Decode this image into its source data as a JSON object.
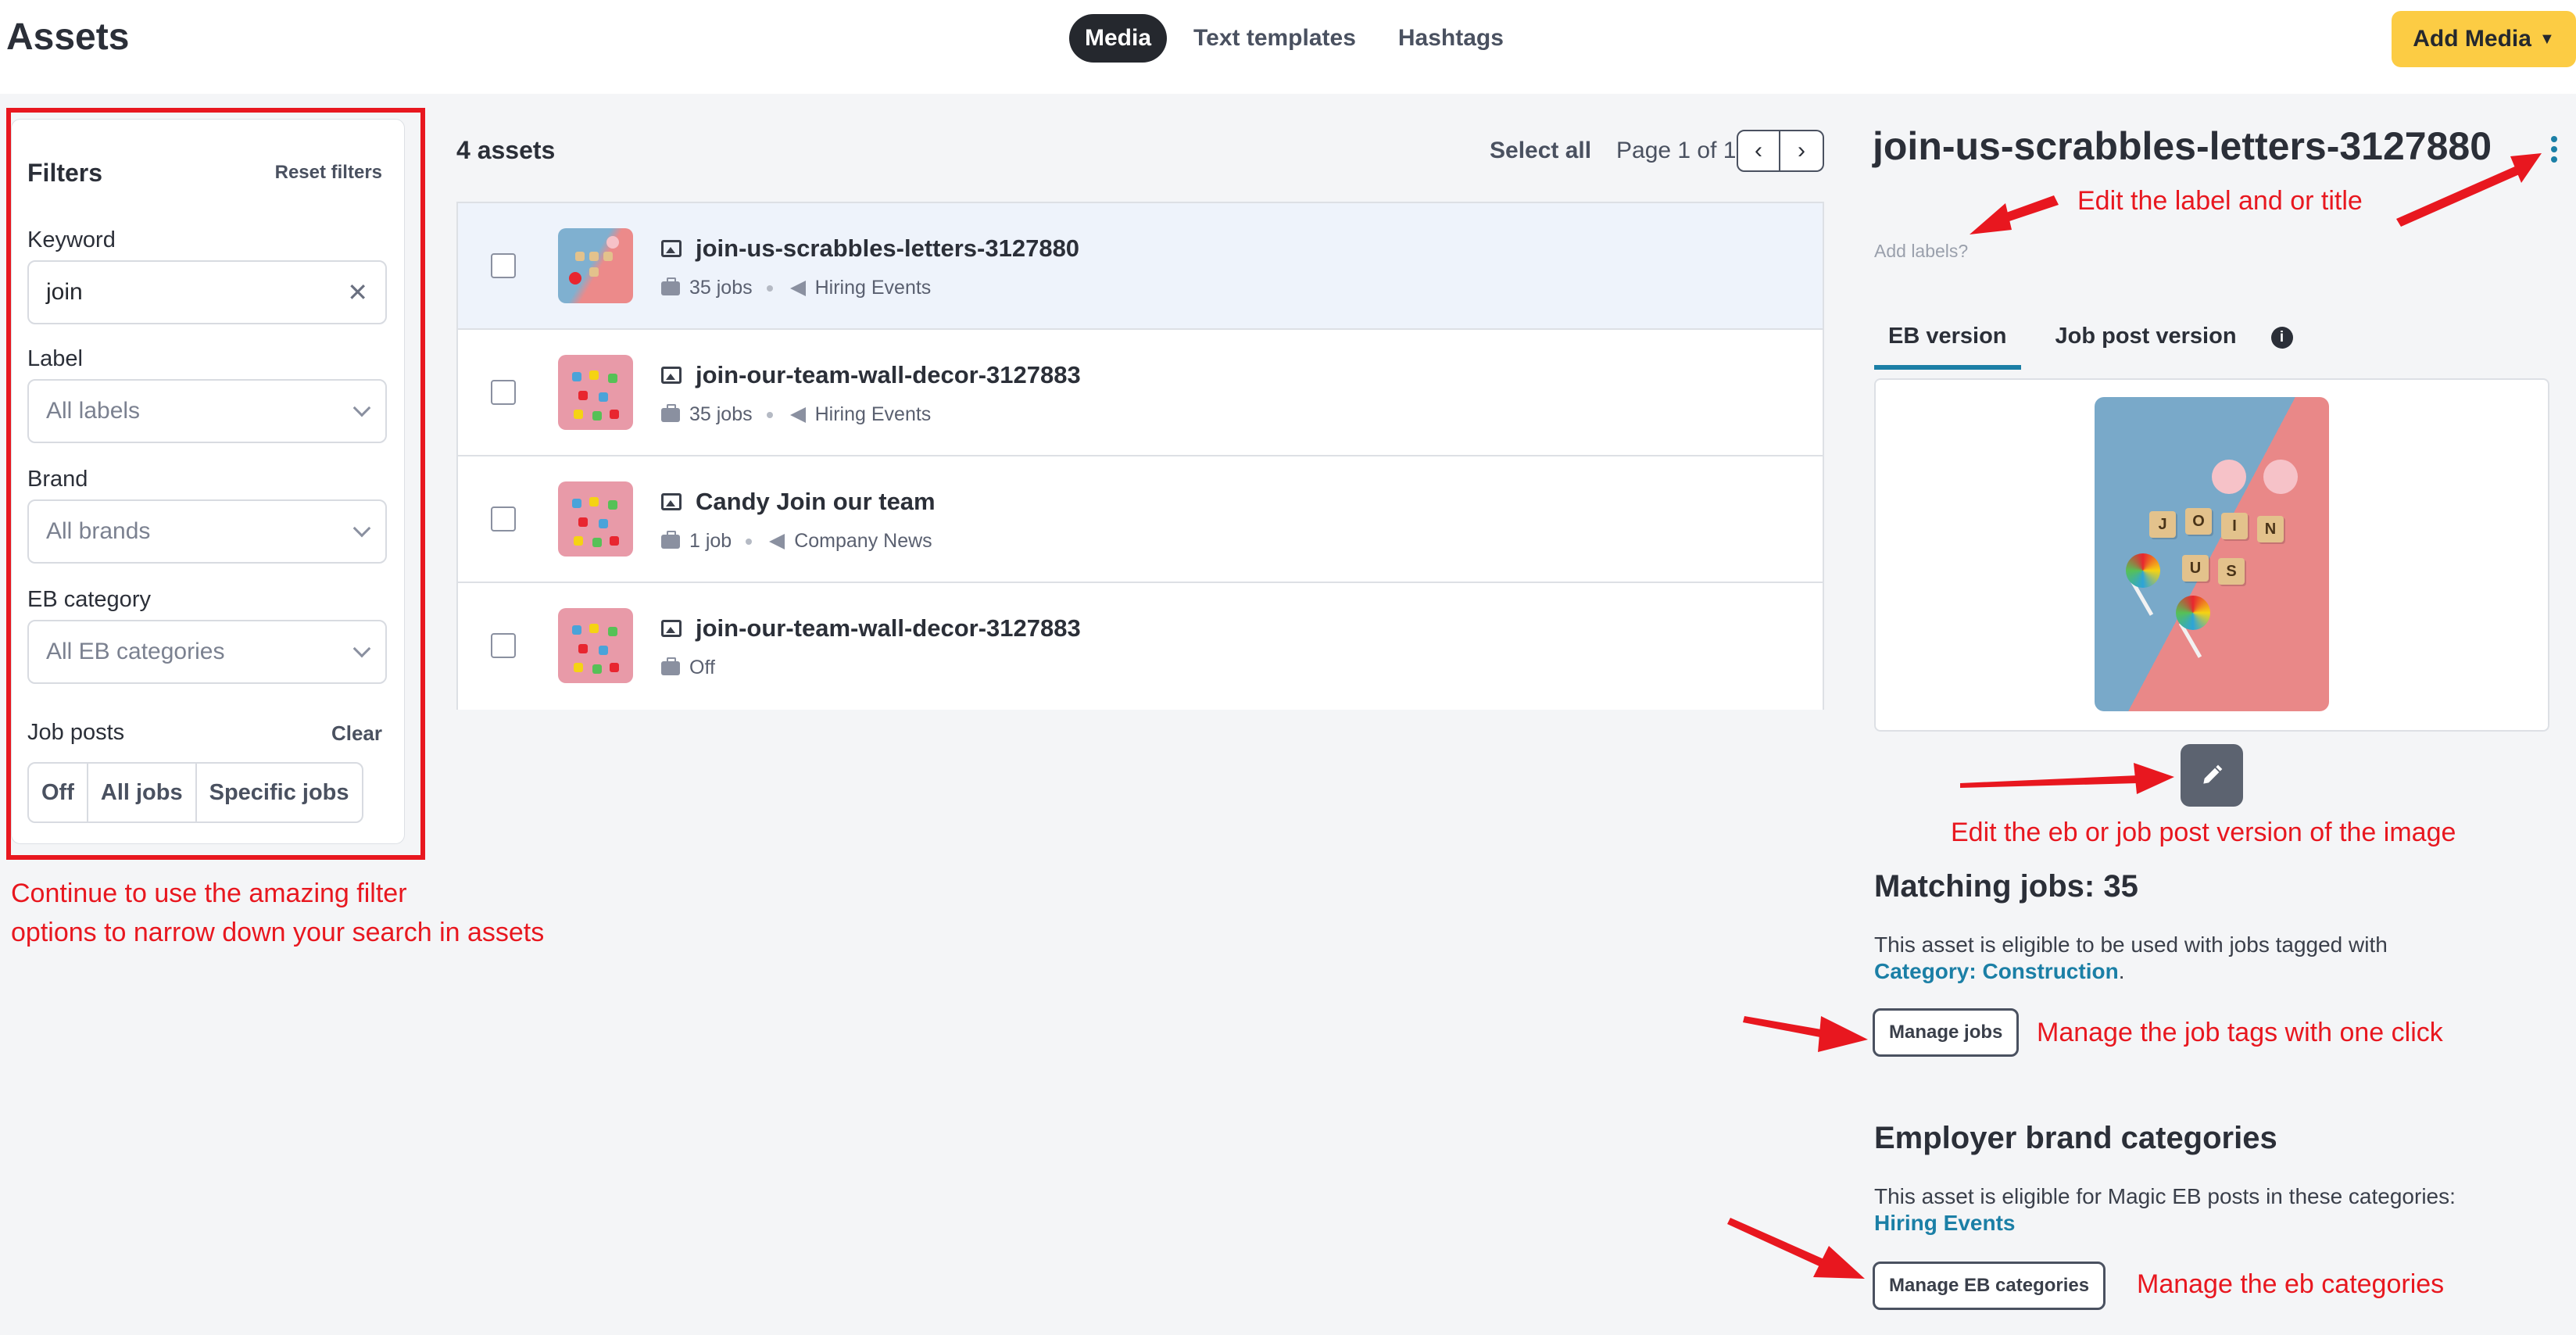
{
  "header": {
    "title": "Assets",
    "tabs": [
      "Media",
      "Text templates",
      "Hashtags"
    ],
    "active_tab": "Media",
    "add_media_label": "Add Media"
  },
  "filters": {
    "title": "Filters",
    "reset_label": "Reset filters",
    "keyword_label": "Keyword",
    "keyword_value": "join",
    "label_label": "Label",
    "label_value": "All labels",
    "brand_label": "Brand",
    "brand_value": "All brands",
    "category_label": "EB category",
    "category_value": "All EB categories",
    "job_posts_label": "Job posts",
    "clear_label": "Clear",
    "job_post_options": [
      "Off",
      "All jobs",
      "Specific jobs"
    ]
  },
  "list": {
    "count_label": "4 assets",
    "select_all_label": "Select all",
    "page_label": "Page 1 of 1",
    "rows": [
      {
        "title": "join-us-scrabbles-letters-3127880",
        "jobs": "35 jobs",
        "category": "Hiring Events",
        "selected": true
      },
      {
        "title": "join-our-team-wall-decor-3127883",
        "jobs": "35 jobs",
        "category": "Hiring Events",
        "selected": false
      },
      {
        "title": "Candy Join our team",
        "jobs": "1 job",
        "category": "Company News",
        "selected": false
      },
      {
        "title": "join-our-team-wall-decor-3127883",
        "jobs": "Off",
        "category": "",
        "selected": false
      }
    ]
  },
  "detail": {
    "title": "join-us-scrabbles-letters-3127880",
    "add_labels": "Add labels?",
    "version_tabs": [
      "EB version",
      "Job post version"
    ],
    "active_version": "EB version",
    "tiles_row1": [
      "J",
      "O",
      "I",
      "N"
    ],
    "tiles_row2": [
      "U",
      "S"
    ],
    "matching_jobs_title": "Matching jobs: 35",
    "matching_jobs_text": "This asset is eligible to be used with jobs tagged with",
    "matching_jobs_link": "Category: Construction",
    "matching_jobs_period": ".",
    "manage_jobs_label": "Manage jobs",
    "eb_categories_title": "Employer brand categories",
    "eb_categories_text": "This asset is eligible for Magic EB posts in these categories:",
    "eb_categories_link": "Hiring Events",
    "manage_eb_label": "Manage EB categories"
  },
  "annotations": {
    "filters_note_line1": "Continue to use the amazing filter",
    "filters_note_line2": "options to narrow down your search in assets",
    "title_note": "Edit the label and or title",
    "image_note": "Edit the eb or job post version of the image",
    "jobs_note": "Manage the job tags with one click",
    "eb_note": "Manage the eb categories"
  },
  "colors": {
    "annotation_red": "#e8171f",
    "accent_yellow": "#fccc44",
    "link_teal": "#1b7fa6",
    "dark_pill": "#25282e"
  }
}
